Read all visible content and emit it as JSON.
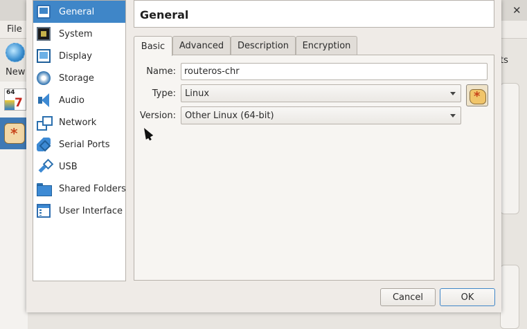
{
  "background": {
    "menu_file": "File",
    "new_label": "New",
    "right_fragment": "ts",
    "vm_icon_text_1": "64",
    "vm_icon_text_2": "7"
  },
  "dialog": {
    "title": "General",
    "categories": [
      {
        "label": "General",
        "icon": "general-icon",
        "selected": true
      },
      {
        "label": "System",
        "icon": "system-icon"
      },
      {
        "label": "Display",
        "icon": "display-icon"
      },
      {
        "label": "Storage",
        "icon": "storage-icon"
      },
      {
        "label": "Audio",
        "icon": "audio-icon"
      },
      {
        "label": "Network",
        "icon": "network-icon"
      },
      {
        "label": "Serial Ports",
        "icon": "serial-ports-icon"
      },
      {
        "label": "USB",
        "icon": "usb-icon"
      },
      {
        "label": "Shared Folders",
        "icon": "shared-folders-icon"
      },
      {
        "label": "User Interface",
        "icon": "user-interface-icon"
      }
    ],
    "tabs": [
      {
        "label": "Basic",
        "active": true
      },
      {
        "label": "Advanced"
      },
      {
        "label": "Description"
      },
      {
        "label": "Encryption"
      }
    ],
    "basic": {
      "name_label": "Name:",
      "name_value": "routeros-chr",
      "type_label": "Type:",
      "type_value": "Linux",
      "version_label": "Version:",
      "version_value": "Other Linux (64-bit)"
    },
    "buttons": {
      "cancel": "Cancel",
      "ok": "OK"
    }
  },
  "colors": {
    "selection": "#3f86c8",
    "dialog_bg": "#efebe7"
  }
}
